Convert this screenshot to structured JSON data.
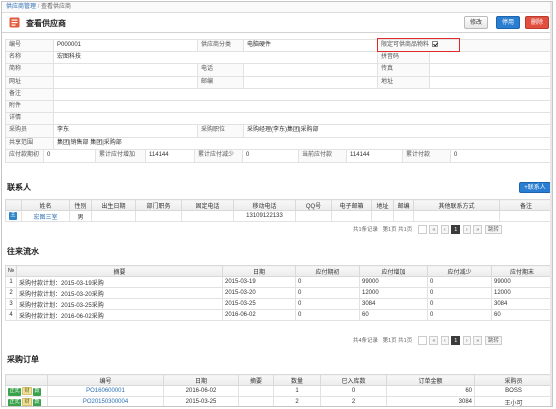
{
  "breadcrumb": {
    "root": "供应商管理",
    "sep": "/",
    "current": "查看供应商"
  },
  "header": {
    "title": "查看供应商",
    "edit_label": "修改",
    "disable_label": "停用",
    "delete_label": "删除"
  },
  "info": {
    "code_label": "编号",
    "code": "P000001",
    "category_label": "供应商分类",
    "category": "电脑硬件",
    "restrict_label": "限定可供商品物料",
    "name_label": "名称",
    "name": "宏图科技",
    "pinyin_label": "拼音码",
    "pinyin": "",
    "short_label": "简称",
    "short": "",
    "phone_label": "电话",
    "phone": "",
    "fax_label": "传真",
    "fax": "",
    "website_label": "网址",
    "website": "",
    "postcode_label": "邮编",
    "postcode": "",
    "address_label": "地址",
    "address": "",
    "remark_label": "备注",
    "remark": "",
    "attach_label": "附件",
    "attach": "",
    "detail_label": "详情",
    "detail": "",
    "buyer_label": "采购员",
    "buyer": "李东",
    "buyer_pos_label": "采购职位",
    "buyer_pos": "采购经理(李东)集团|采购部",
    "shared_label": "共享范围",
    "shared": "集团|销售部 集团|采购部",
    "stat_labels": [
      "应付款期初",
      "累计应付增加",
      "累计应付减少",
      "当前应付款",
      "累计付款"
    ],
    "stat_values": [
      "0",
      "114144",
      "0",
      "114144",
      "0"
    ]
  },
  "contacts": {
    "title": "联系人",
    "add_label": "+联系人",
    "headers": [
      "",
      "姓名",
      "性别",
      "出生日期",
      "部门职务",
      "固定电话",
      "移动电话",
      "QQ号",
      "电子邮箱",
      "地址",
      "邮编",
      "其他联系方式",
      "备注"
    ],
    "rows": [
      {
        "badge": "主",
        "name": "宏图三室",
        "gender": "男",
        "birth": "",
        "dept": "",
        "tel": "",
        "mobile": "13109122133",
        "qq": "",
        "email": "",
        "addr": "",
        "zip": "",
        "other": "",
        "note": ""
      }
    ],
    "pager": {
      "summary": "共1条记录",
      "page_info": "第1页 共1页",
      "first": "«",
      "prev": "‹",
      "cur": "1",
      "next": "›",
      "last": "»",
      "go": "跳转"
    }
  },
  "ledger": {
    "title": "往来流水",
    "headers": [
      "№",
      "摘要",
      "日期",
      "应付期初",
      "应付增加",
      "应付减少",
      "应付期末"
    ],
    "rows": [
      {
        "no": "1",
        "summary": "采购付款计划：2015-03-19采购",
        "date": "2015-03-19",
        "open": "0",
        "inc": "99000",
        "dec": "0",
        "close": "99000"
      },
      {
        "no": "2",
        "summary": "采购付款计划：2015-03-20采购",
        "date": "2015-03-20",
        "open": "0",
        "inc": "12000",
        "dec": "0",
        "close": "12000"
      },
      {
        "no": "3",
        "summary": "采购付款计划：2015-03-25采购",
        "date": "2015-03-25",
        "open": "0",
        "inc": "3084",
        "dec": "0",
        "close": "3084"
      },
      {
        "no": "4",
        "summary": "采购付款计划：2016-06-02采购",
        "date": "2016-06-02",
        "open": "0",
        "inc": "60",
        "dec": "0",
        "close": "60"
      }
    ],
    "pager": {
      "summary": "共4条记录",
      "page_info": "第1页 共1页",
      "first": "«",
      "prev": "‹",
      "cur": "1",
      "next": "›",
      "last": "»",
      "go": "跳转"
    }
  },
  "orders": {
    "title": "采购订单",
    "headers": [
      "",
      "编号",
      "日期",
      "摘要",
      "数量",
      "已入库数",
      "订单金额",
      "采购员"
    ],
    "rows": [
      {
        "tags": [
          "正式",
          "财",
          "款"
        ],
        "code": "PO160600001",
        "date": "2016-06-02",
        "summary": "",
        "qty": "1",
        "in": "0",
        "amount": "60",
        "buyer": "BOSS"
      },
      {
        "tags": [
          "正式",
          "财",
          "款"
        ],
        "code": "PO20150300004",
        "date": "2015-03-25",
        "summary": "",
        "qty": "2",
        "in": "2",
        "amount": "3084",
        "buyer": "王小可"
      }
    ]
  }
}
